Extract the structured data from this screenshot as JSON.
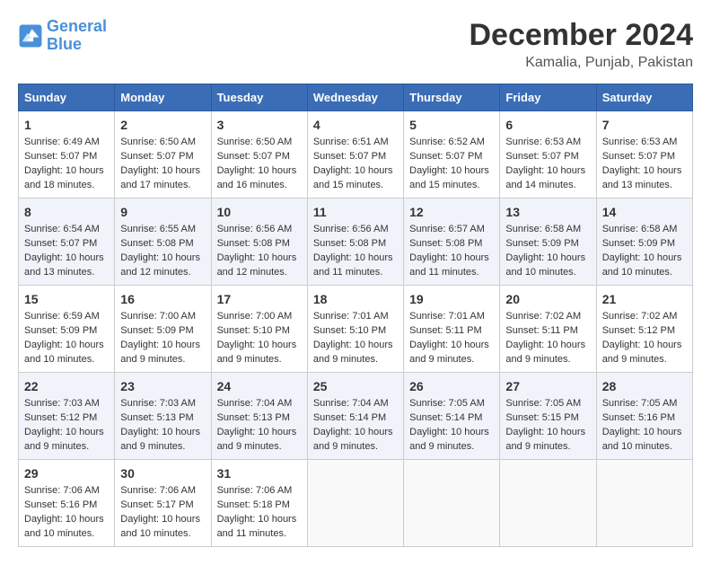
{
  "logo": {
    "line1": "General",
    "line2": "Blue"
  },
  "header": {
    "month": "December 2024",
    "location": "Kamalia, Punjab, Pakistan"
  },
  "columns": [
    "Sunday",
    "Monday",
    "Tuesday",
    "Wednesday",
    "Thursday",
    "Friday",
    "Saturday"
  ],
  "weeks": [
    [
      {
        "day": "1",
        "sunrise": "6:49 AM",
        "sunset": "5:07 PM",
        "daylight": "10 hours and 18 minutes."
      },
      {
        "day": "2",
        "sunrise": "6:50 AM",
        "sunset": "5:07 PM",
        "daylight": "10 hours and 17 minutes."
      },
      {
        "day": "3",
        "sunrise": "6:50 AM",
        "sunset": "5:07 PM",
        "daylight": "10 hours and 16 minutes."
      },
      {
        "day": "4",
        "sunrise": "6:51 AM",
        "sunset": "5:07 PM",
        "daylight": "10 hours and 15 minutes."
      },
      {
        "day": "5",
        "sunrise": "6:52 AM",
        "sunset": "5:07 PM",
        "daylight": "10 hours and 15 minutes."
      },
      {
        "day": "6",
        "sunrise": "6:53 AM",
        "sunset": "5:07 PM",
        "daylight": "10 hours and 14 minutes."
      },
      {
        "day": "7",
        "sunrise": "6:53 AM",
        "sunset": "5:07 PM",
        "daylight": "10 hours and 13 minutes."
      }
    ],
    [
      {
        "day": "8",
        "sunrise": "6:54 AM",
        "sunset": "5:07 PM",
        "daylight": "10 hours and 13 minutes."
      },
      {
        "day": "9",
        "sunrise": "6:55 AM",
        "sunset": "5:08 PM",
        "daylight": "10 hours and 12 minutes."
      },
      {
        "day": "10",
        "sunrise": "6:56 AM",
        "sunset": "5:08 PM",
        "daylight": "10 hours and 12 minutes."
      },
      {
        "day": "11",
        "sunrise": "6:56 AM",
        "sunset": "5:08 PM",
        "daylight": "10 hours and 11 minutes."
      },
      {
        "day": "12",
        "sunrise": "6:57 AM",
        "sunset": "5:08 PM",
        "daylight": "10 hours and 11 minutes."
      },
      {
        "day": "13",
        "sunrise": "6:58 AM",
        "sunset": "5:09 PM",
        "daylight": "10 hours and 10 minutes."
      },
      {
        "day": "14",
        "sunrise": "6:58 AM",
        "sunset": "5:09 PM",
        "daylight": "10 hours and 10 minutes."
      }
    ],
    [
      {
        "day": "15",
        "sunrise": "6:59 AM",
        "sunset": "5:09 PM",
        "daylight": "10 hours and 10 minutes."
      },
      {
        "day": "16",
        "sunrise": "7:00 AM",
        "sunset": "5:09 PM",
        "daylight": "10 hours and 9 minutes."
      },
      {
        "day": "17",
        "sunrise": "7:00 AM",
        "sunset": "5:10 PM",
        "daylight": "10 hours and 9 minutes."
      },
      {
        "day": "18",
        "sunrise": "7:01 AM",
        "sunset": "5:10 PM",
        "daylight": "10 hours and 9 minutes."
      },
      {
        "day": "19",
        "sunrise": "7:01 AM",
        "sunset": "5:11 PM",
        "daylight": "10 hours and 9 minutes."
      },
      {
        "day": "20",
        "sunrise": "7:02 AM",
        "sunset": "5:11 PM",
        "daylight": "10 hours and 9 minutes."
      },
      {
        "day": "21",
        "sunrise": "7:02 AM",
        "sunset": "5:12 PM",
        "daylight": "10 hours and 9 minutes."
      }
    ],
    [
      {
        "day": "22",
        "sunrise": "7:03 AM",
        "sunset": "5:12 PM",
        "daylight": "10 hours and 9 minutes."
      },
      {
        "day": "23",
        "sunrise": "7:03 AM",
        "sunset": "5:13 PM",
        "daylight": "10 hours and 9 minutes."
      },
      {
        "day": "24",
        "sunrise": "7:04 AM",
        "sunset": "5:13 PM",
        "daylight": "10 hours and 9 minutes."
      },
      {
        "day": "25",
        "sunrise": "7:04 AM",
        "sunset": "5:14 PM",
        "daylight": "10 hours and 9 minutes."
      },
      {
        "day": "26",
        "sunrise": "7:05 AM",
        "sunset": "5:14 PM",
        "daylight": "10 hours and 9 minutes."
      },
      {
        "day": "27",
        "sunrise": "7:05 AM",
        "sunset": "5:15 PM",
        "daylight": "10 hours and 9 minutes."
      },
      {
        "day": "28",
        "sunrise": "7:05 AM",
        "sunset": "5:16 PM",
        "daylight": "10 hours and 10 minutes."
      }
    ],
    [
      {
        "day": "29",
        "sunrise": "7:06 AM",
        "sunset": "5:16 PM",
        "daylight": "10 hours and 10 minutes."
      },
      {
        "day": "30",
        "sunrise": "7:06 AM",
        "sunset": "5:17 PM",
        "daylight": "10 hours and 10 minutes."
      },
      {
        "day": "31",
        "sunrise": "7:06 AM",
        "sunset": "5:18 PM",
        "daylight": "10 hours and 11 minutes."
      },
      null,
      null,
      null,
      null
    ]
  ],
  "labels": {
    "sunrise": "Sunrise:",
    "sunset": "Sunset:",
    "daylight": "Daylight:"
  }
}
